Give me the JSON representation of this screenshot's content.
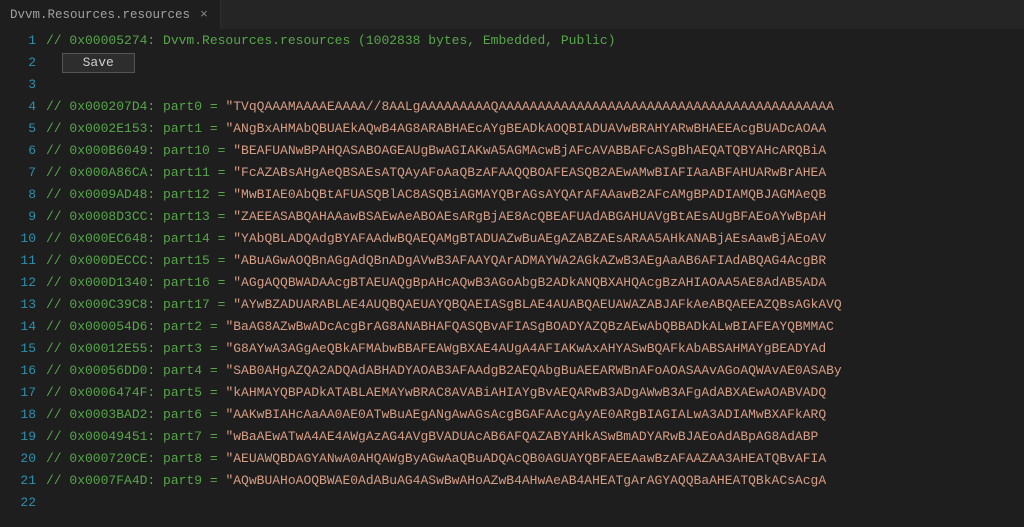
{
  "tab": {
    "title": "Dvvm.Resources.resources",
    "close_glyph": "×"
  },
  "save_button_label": "Save",
  "header_comment": "// 0x00005274: Dvvm.Resources.resources (1002838 bytes, Embedded, Public)",
  "lines": [
    {
      "num": 1,
      "type": "header"
    },
    {
      "num": 2,
      "type": "button"
    },
    {
      "num": 3,
      "type": "blank"
    },
    {
      "num": 4,
      "type": "data",
      "prefix": "// 0x000207D4: part0 = ",
      "str": "\"TVqQAAAMAAAAEAAAA//8AALgAAAAAAAAAQAAAAAAAAAAAAAAAAAAAAAAAAAAAAAAAAAAAAAAAAAAA"
    },
    {
      "num": 5,
      "type": "data",
      "prefix": "// 0x0002E153: part1 = ",
      "str": "\"ANgBxAHMAbQBUAEkAQwB4AG8ARABHAEcAYgBEADkAOQBIADUAVwBRAHYARwBHAEEAcgBUADcAOAA"
    },
    {
      "num": 6,
      "type": "data",
      "prefix": "// 0x000B6049: part10 = ",
      "str": "\"BEAFUANwBPAHQASABOAGEAUgBwAGIAKwA5AGMAcwBjAFcAVABBAFcASgBhAEQATQBYAHcARQBiA"
    },
    {
      "num": 7,
      "type": "data",
      "prefix": "// 0x000A86CA: part11 = ",
      "str": "\"FcAZABsAHgAeQBSAEsATQAyAFoAaQBzAFAAQQBOAFEASQB2AEwAMwBIAFIAaABFAHUARwBrAHEA"
    },
    {
      "num": 8,
      "type": "data",
      "prefix": "// 0x0009AD48: part12 = ",
      "str": "\"MwBIAE0AbQBtAFUASQBlAC8ASQBiAGMAYQBrAGsAYQArAFAAawB2AFcAMgBPADIAMQBJAGMAeQB"
    },
    {
      "num": 9,
      "type": "data",
      "prefix": "// 0x0008D3CC: part13 = ",
      "str": "\"ZAEEASABQAHAAawBSAEwAeABOAEsARgBjAE8AcQBEAFUAdABGAHUAVgBtAEsAUgBFAEoAYwBpAH"
    },
    {
      "num": 10,
      "type": "data",
      "prefix": "// 0x000EC648: part14 = ",
      "str": "\"YAbQBLADQAdgBYAFAAdwBQAEQAMgBTADUAZwBuAEgAZABZAEsARAA5AHkANABjAEsAawBjAEoAV"
    },
    {
      "num": 11,
      "type": "data",
      "prefix": "// 0x000DECCC: part15 = ",
      "str": "\"ABuAGwAOQBnAGgAdQBnADgAVwB3AFAAYQArADMAYWA2AGkAZwB3AEgAaAB6AFIAdABQAG4AcgBR"
    },
    {
      "num": 12,
      "type": "data",
      "prefix": "// 0x000D1340: part16 = ",
      "str": "\"AGgAQQBWADAAcgBTAEUAQgBpAHcAQwB3AGoAbgB2ADkANQBXAHQAcgBzAHIAOAA5AE8AdAB5ADA"
    },
    {
      "num": 13,
      "type": "data",
      "prefix": "// 0x000C39C8: part17 = ",
      "str": "\"AYwBZADUARABLAE4AUQBQAEUAYQBQAEIASgBLAE4AUABQAEUAWAZABJAFkAeABQAEEAZQBsAGkAVQ"
    },
    {
      "num": 14,
      "type": "data",
      "prefix": "// 0x000054D6: part2 = ",
      "str": "\"BaAG8AZwBwADcAcgBrAG8ANABHAFQASQBvAFIASgBOADYAZQBzAEwAbQBBADkALwBIAFEAYQBMMAC"
    },
    {
      "num": 15,
      "type": "data",
      "prefix": "// 0x00012E55: part3 = ",
      "str": "\"G8AYwA3AGgAeQBkAFMAbwBBAFEAWgBXAE4AUgA4AFIAKwAxAHYASwBQAFkAbABSAHMAYgBEADYAd"
    },
    {
      "num": 16,
      "type": "data",
      "prefix": "// 0x00056DD0: part4 = ",
      "str": "\"SAB0AHgAZQA2ADQAdABHADYAOAB3AFAAdgB2AEQAbgBuAEEARWBnAFoAOASAAvAGoAQWAvAE0ASABy"
    },
    {
      "num": 17,
      "type": "data",
      "prefix": "// 0x0006474F: part5 = ",
      "str": "\"kAHMAYQBPADkATABLAEMAYwBRAC8AVABiAHIAYgBvAEQARwB3ADgAWwB3AFgAdABXAEwAOABVADQ"
    },
    {
      "num": 18,
      "type": "data",
      "prefix": "// 0x0003BAD2: part6 = ",
      "str": "\"AAKwBIAHcAaAA0AE0ATwBuAEgANgAwAGsAcgBGAFAAcgAyAE0ARgBIAGIALwA3ADIAMwBXAFkARQ"
    },
    {
      "num": 19,
      "type": "data",
      "prefix": "// 0x00049451: part7 = ",
      "str": "\"wBaAEwATwA4AE4AWgAzAG4AVgBVADUAcAB6AFQAZABYAHkASwBmADYARwBJAEoAdABpAG8AdABP"
    },
    {
      "num": 20,
      "type": "data",
      "prefix": "// 0x000720CE: part8 = ",
      "str": "\"AEUAWQBDAGYANwA0AHQAWgByAGwAaQBuADQAcQB0AGUAYQBFAEEAawBzAFAAZAA3AHEATQBvAFIA"
    },
    {
      "num": 21,
      "type": "data",
      "prefix": "// 0x0007FA4D: part9 = ",
      "str": "\"AQwBUAHoAOQBWAE0AdABuAG4ASwBwAHoAZwB4AHwAeAB4AHEATgArAGYAQQBaAHEATQBkACsAcgA"
    },
    {
      "num": 22,
      "type": "blank"
    }
  ]
}
